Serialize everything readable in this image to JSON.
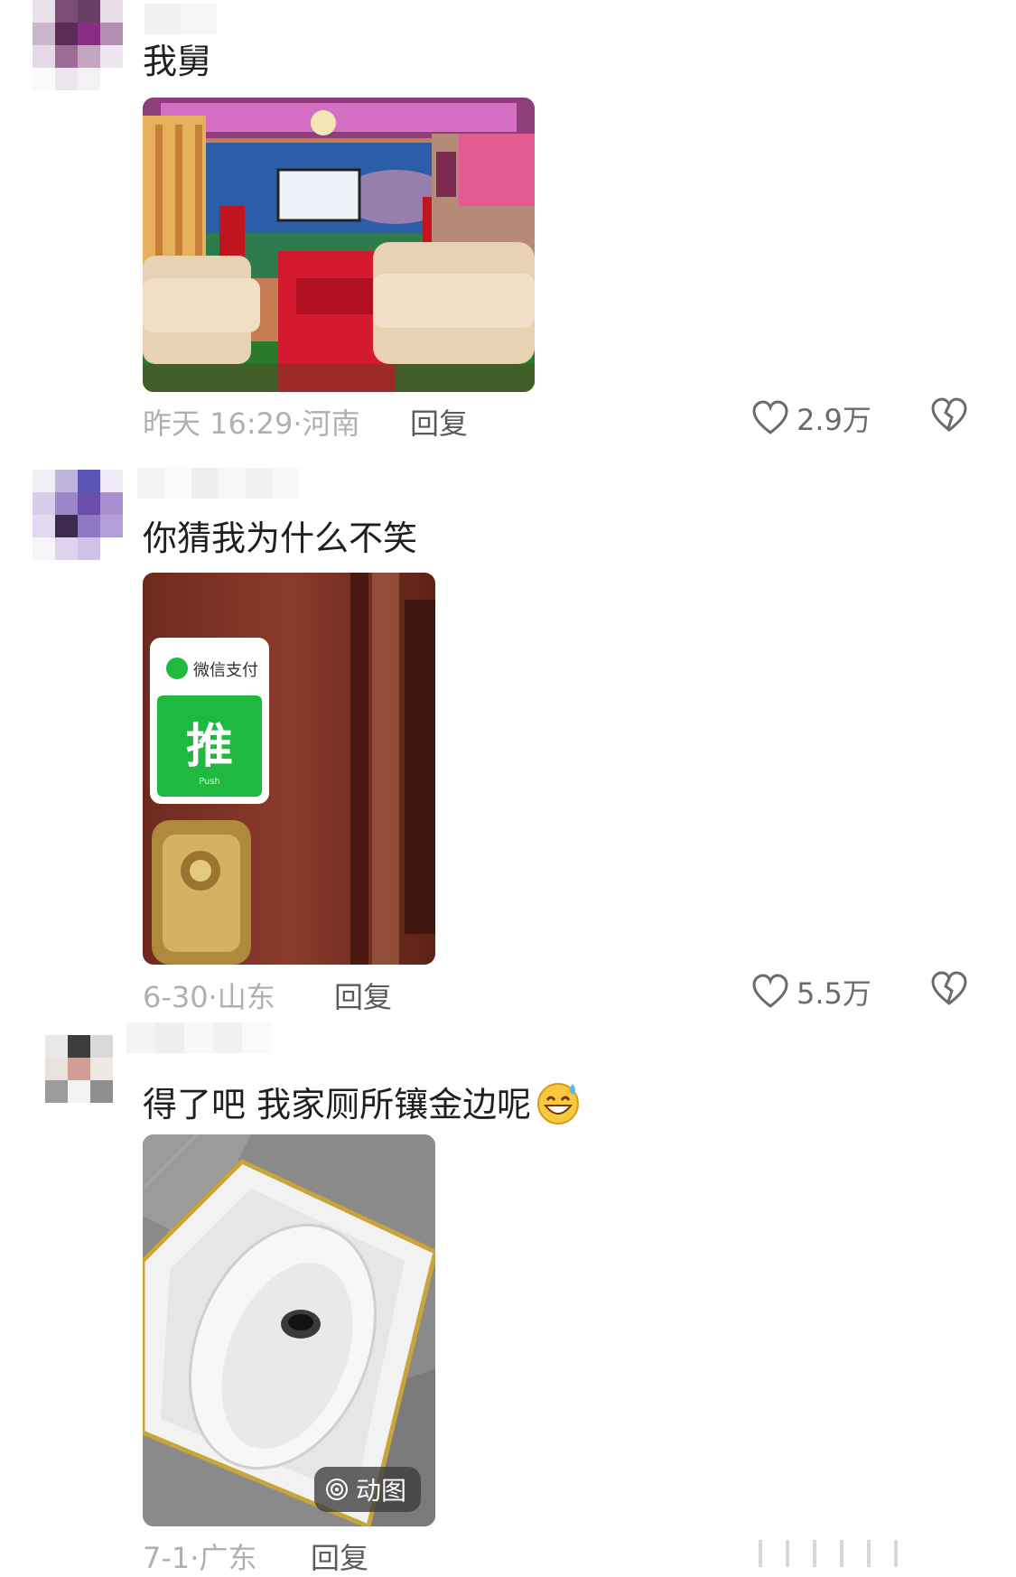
{
  "comments": [
    {
      "text": "我舅",
      "date": "昨天 16:29",
      "location": "河南",
      "reply_label": "回复",
      "likes": "2.9万",
      "image": "living-room-photo"
    },
    {
      "text": "你猜我为什么不笑",
      "date": "6-30",
      "location": "山东",
      "reply_label": "回复",
      "likes": "5.5万",
      "image": "door-push-sign-photo",
      "image_sign": {
        "brand": "微信支付",
        "word": "推",
        "small": "Push"
      }
    },
    {
      "text": "得了吧 我家厕所镶金边呢",
      "emoji": "grinning-sweat-emoji",
      "date": "7-1",
      "location": "广东",
      "reply_label": "回复",
      "image": "gold-trim-toilet-photo",
      "image_badge": "动图"
    }
  ],
  "separator": "·",
  "colors": {
    "meta": "#b0b0b0",
    "reply": "#5b5b5b",
    "wechat_green": "#1fb93f"
  },
  "icons": [
    "heart-outline-icon",
    "broken-heart-icon",
    "gif-play-icon"
  ]
}
